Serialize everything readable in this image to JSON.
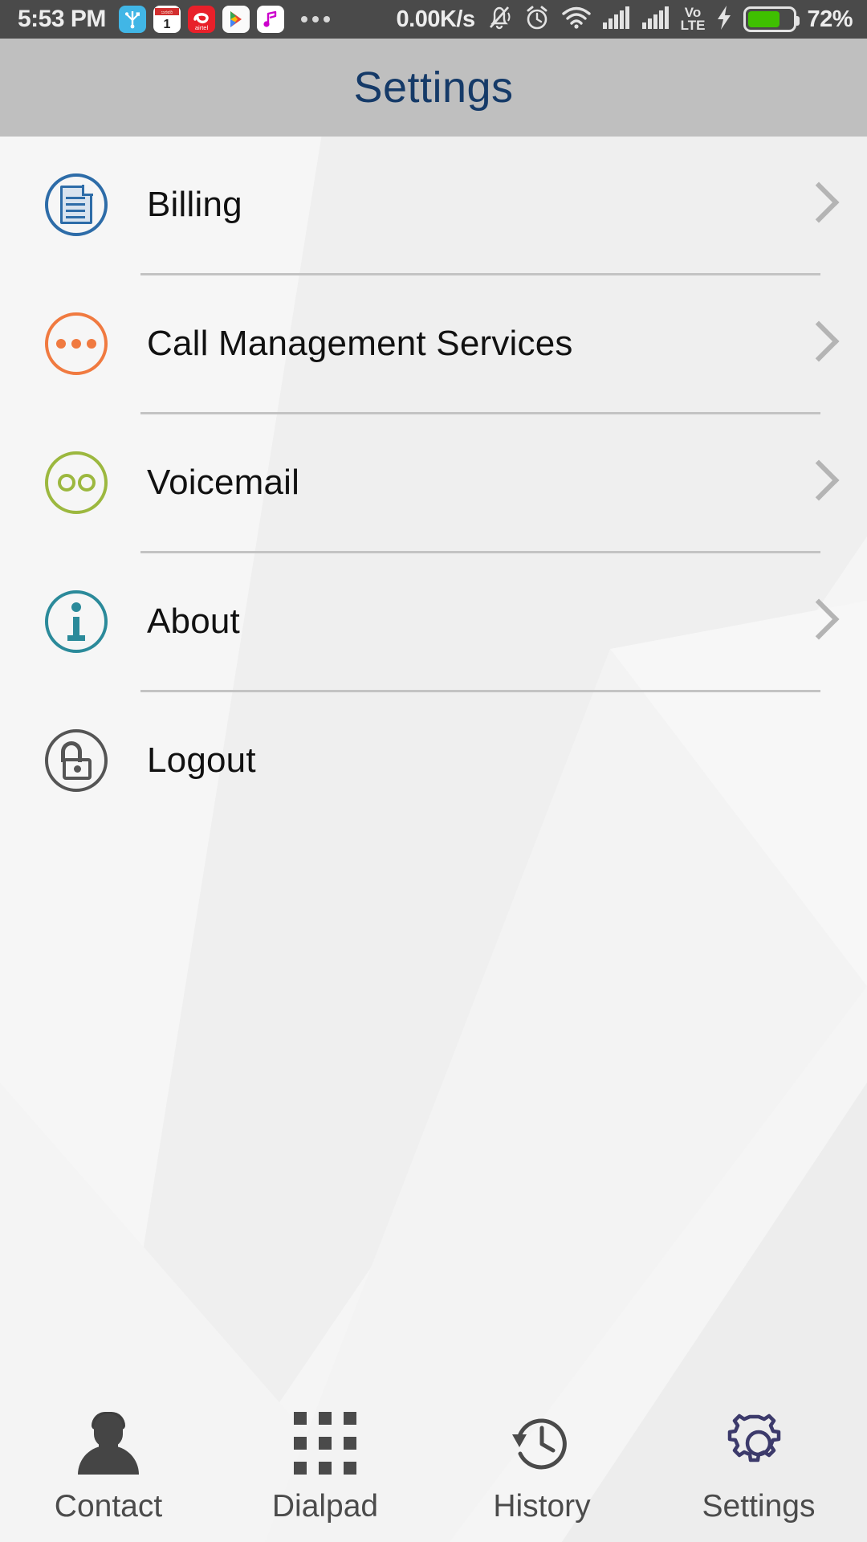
{
  "status_bar": {
    "time": "5:53 PM",
    "network_speed": "0.00K/s",
    "battery_percent": "72%",
    "battery_level": 72,
    "app_icons": [
      "usb-icon",
      "calendar-icon",
      "airtel-icon",
      "play-store-icon",
      "music-icon",
      "more-dots-icon"
    ],
    "calendar_day": "1",
    "calendar_month": "ಜನವರಿ",
    "airtel_label": "airtel",
    "system_icons": [
      "silent-bell-icon",
      "alarm-icon",
      "wifi-icon",
      "signal-sim1-icon",
      "signal-sim2-icon",
      "volte-icon",
      "charging-bolt-icon",
      "battery-icon"
    ],
    "volte_top": "Vo",
    "volte_bottom": "LTE"
  },
  "header": {
    "title": "Settings",
    "title_color": "#153a68",
    "background_color": "#bfbfbf"
  },
  "list": {
    "items": [
      {
        "label": "Billing",
        "icon": "document-icon",
        "color": "#2d6ca8",
        "has_chevron": true
      },
      {
        "label": "Call Management Services",
        "icon": "three-dots-icon",
        "color": "#f07a40",
        "has_chevron": true
      },
      {
        "label": "Voicemail",
        "icon": "voicemail-icon",
        "color": "#9cb83f",
        "has_chevron": true
      },
      {
        "label": "About",
        "icon": "info-icon",
        "color": "#2b8a9a",
        "has_chevron": true
      },
      {
        "label": "Logout",
        "icon": "unlock-icon",
        "color": "#555555",
        "has_chevron": false
      }
    ]
  },
  "bottom_nav": {
    "active": "Settings",
    "active_color": "#3c3a6b",
    "tabs": [
      {
        "label": "Contact",
        "icon": "person-icon"
      },
      {
        "label": "Dialpad",
        "icon": "dialpad-grid-icon"
      },
      {
        "label": "History",
        "icon": "clock-history-icon"
      },
      {
        "label": "Settings",
        "icon": "gear-icon"
      }
    ]
  }
}
